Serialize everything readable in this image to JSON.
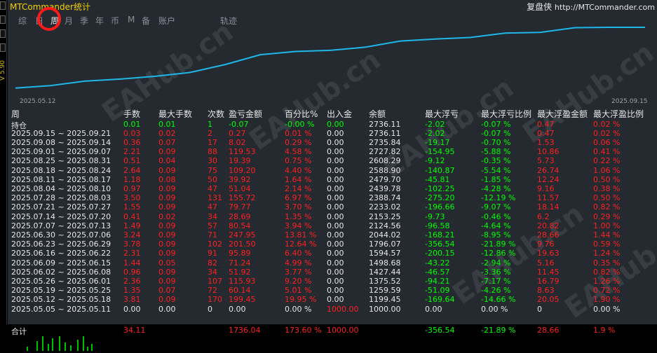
{
  "title": "MTCommander统计",
  "brand": {
    "name": "复盘侠",
    "url": "http://MTCommander.com"
  },
  "left_toolbar": {
    "version": "V 5.90"
  },
  "tabs": [
    "综",
    "日",
    "周",
    "月",
    "季",
    "年",
    "币",
    "M",
    "备",
    "账户",
    "轨迹"
  ],
  "active_tab": "周",
  "chart": {
    "x_start": "2025.05.12",
    "x_end": "2025.09.15",
    "color": "#1fb6e8"
  },
  "chart_data": {
    "type": "line",
    "x": [
      "2025.05.12",
      "2025.05.19",
      "2025.05.26",
      "2025.06.02",
      "2025.06.09",
      "2025.06.16",
      "2025.06.23",
      "2025.06.30",
      "2025.07.07",
      "2025.07.14",
      "2025.07.21",
      "2025.07.28",
      "2025.08.04",
      "2025.08.11",
      "2025.08.18",
      "2025.08.25",
      "2025.09.01",
      "2025.09.08",
      "2025.09.15"
    ],
    "values": [
      1199.45,
      1259.59,
      1375.52,
      1427.44,
      1498.68,
      1594.57,
      1796.07,
      2044.02,
      2124.56,
      2153.25,
      2233.02,
      2388.74,
      2439.78,
      2479.7,
      2588.9,
      2608.29,
      2727.82,
      2735.84,
      2736.11
    ]
  },
  "table": {
    "headers": [
      "周",
      "手数",
      "最大手数",
      "次数",
      "盈亏金额",
      "百分比%",
      "出入金",
      "余额",
      "最大浮亏",
      "最大浮亏比例",
      "最大浮盈金额",
      "最大浮盈比例"
    ],
    "position": [
      "持仓",
      "0.01",
      "0.01",
      "1",
      "-0.07",
      "-0.00 %",
      "0.00",
      "2736.11",
      "-2.02",
      "-0.07 %",
      "0.47",
      "0.02 %"
    ],
    "rows": [
      [
        "2025.09.15 ~ 2025.09.21",
        "0.03",
        "0.02",
        "2",
        "0.27",
        "0.01 %",
        "0.00",
        "2736.11",
        "-2.02",
        "-0.07 %",
        "0.47",
        "0.02 %"
      ],
      [
        "2025.09.08 ~ 2025.09.14",
        "0.36",
        "0.07",
        "17",
        "8.02",
        "0.29 %",
        "0.00",
        "2735.84",
        "-19.17",
        "-0.70 %",
        "1.53",
        "0.06 %"
      ],
      [
        "2025.09.01 ~ 2025.09.07",
        "2.21",
        "0.09",
        "88",
        "119.53",
        "4.58 %",
        "0.00",
        "2727.82",
        "-154.95",
        "-5.88 %",
        "10.86",
        "0.41 %"
      ],
      [
        "2025.08.25 ~ 2025.08.31",
        "0.51",
        "0.04",
        "30",
        "19.39",
        "0.75 %",
        "0.00",
        "2608.29",
        "-9.12",
        "-0.35 %",
        "5.73",
        "0.22 %"
      ],
      [
        "2025.08.18 ~ 2025.08.24",
        "2.64",
        "0.09",
        "75",
        "109.20",
        "4.40 %",
        "0.00",
        "2588.90",
        "-140.87",
        "-5.54 %",
        "26.74",
        "1.06 %"
      ],
      [
        "2025.08.11 ~ 2025.08.17",
        "1.18",
        "0.08",
        "50",
        "39.92",
        "1.64 %",
        "0.00",
        "2479.70",
        "-45.81",
        "-1.85 %",
        "12.24",
        "0.50 %"
      ],
      [
        "2025.08.04 ~ 2025.08.10",
        "0.97",
        "0.09",
        "47",
        "51.04",
        "2.14 %",
        "0.00",
        "2439.78",
        "-102.25",
        "-4.28 %",
        "9.16",
        "0.38 %"
      ],
      [
        "2025.07.28 ~ 2025.08.03",
        "3.50",
        "0.09",
        "131",
        "155.72",
        "6.97 %",
        "0.00",
        "2388.74",
        "-275.20",
        "-12.19 %",
        "11.57",
        "0.50 %"
      ],
      [
        "2025.07.21 ~ 2025.07.27",
        "1.55",
        "0.09",
        "47",
        "79.77",
        "3.70 %",
        "0.00",
        "2233.02",
        "-196.66",
        "-9.07 %",
        "18.14",
        "0.82 %"
      ],
      [
        "2025.07.14 ~ 2025.07.20",
        "0.41",
        "0.02",
        "34",
        "28.69",
        "1.35 %",
        "0.00",
        "2153.25",
        "-9.73",
        "-0.46 %",
        "6.2",
        "0.29 %"
      ],
      [
        "2025.07.07 ~ 2025.07.13",
        "1.49",
        "0.09",
        "57",
        "80.54",
        "3.94 %",
        "0.00",
        "2124.56",
        "-96.58",
        "-4.64 %",
        "20.82",
        "1.00 %"
      ],
      [
        "2025.06.30 ~ 2025.07.06",
        "3.24",
        "0.09",
        "71",
        "247.95",
        "13.81 %",
        "0.00",
        "2044.02",
        "-168.21",
        "-8.95 %",
        "28.66",
        "1.44 %"
      ],
      [
        "2025.06.23 ~ 2025.06.29",
        "3.78",
        "0.09",
        "102",
        "201.50",
        "12.64 %",
        "0.00",
        "1796.07",
        "-356.54",
        "-21.89 %",
        "9.76",
        "0.59 %"
      ],
      [
        "2025.06.16 ~ 2025.06.22",
        "2.31",
        "0.09",
        "91",
        "95.89",
        "6.40 %",
        "0.00",
        "1594.57",
        "-200.15",
        "-12.86 %",
        "19.63",
        "1.24 %"
      ],
      [
        "2025.06.09 ~ 2025.06.15",
        "1.44",
        "0.05",
        "82",
        "71.24",
        "4.99 %",
        "0.00",
        "1498.68",
        "-43.22",
        "-2.94 %",
        "5.16",
        "0.35 %"
      ],
      [
        "2025.06.02 ~ 2025.06.08",
        "0.96",
        "0.09",
        "34",
        "51.92",
        "3.77 %",
        "0.00",
        "1427.44",
        "-46.57",
        "-3.36 %",
        "11.45",
        "0.82 %"
      ],
      [
        "2025.05.26 ~ 2025.06.01",
        "2.36",
        "0.09",
        "107",
        "115.93",
        "9.20 %",
        "0.00",
        "1375.52",
        "-94.21",
        "-7.17 %",
        "16.79",
        "1.26 %"
      ],
      [
        "2025.05.19 ~ 2025.05.25",
        "1.35",
        "0.07",
        "72",
        "60.14",
        "5.01 %",
        "0.00",
        "1259.59",
        "-51.09",
        "-4.26 %",
        "8.63",
        "0.72 %"
      ],
      [
        "2025.05.12 ~ 2025.05.18",
        "3.81",
        "0.09",
        "170",
        "199.45",
        "19.95 %",
        "0.00",
        "1199.45",
        "-169.64",
        "-14.66 %",
        "20.05",
        "1.90 %"
      ],
      [
        "2025.05.05 ~ 2025.05.11",
        "0.00",
        "0.00",
        "0",
        "0.00",
        "0.00 %",
        "1000.00",
        "1000.00",
        "0.00",
        "0.00 %",
        "0",
        "0.00 %"
      ]
    ],
    "total": [
      "合计",
      "34.11",
      "",
      "",
      "1736.04",
      "173.60 %",
      "1000.00",
      "",
      "-356.54",
      "-21.89 %",
      "28.66",
      "1.9 %"
    ]
  },
  "watermark": "EAHub.cn"
}
